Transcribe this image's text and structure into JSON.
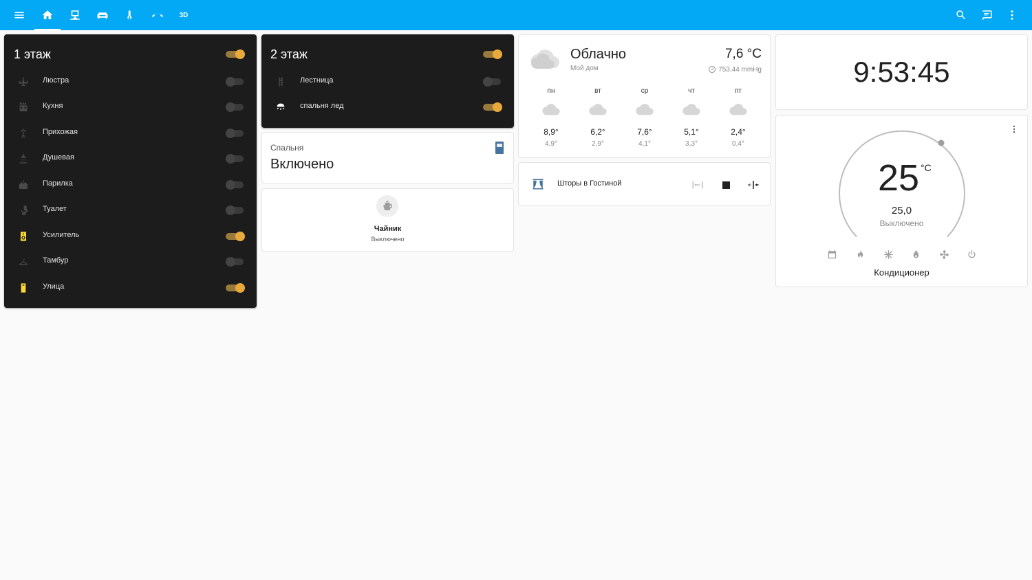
{
  "topbar": {
    "tabs": [
      {
        "icon": "home-icon",
        "active": true
      },
      {
        "icon": "desk-icon"
      },
      {
        "icon": "sofa-icon"
      },
      {
        "icon": "thermometer-icon"
      },
      {
        "icon": "phone-hangup-icon"
      },
      {
        "label": "3D"
      }
    ]
  },
  "floor1": {
    "title": "1 этаж",
    "master_on": true,
    "items": [
      {
        "name": "Люстра",
        "icon": "chandelier-icon",
        "on": false
      },
      {
        "name": "Кухня",
        "icon": "stove-icon",
        "on": false
      },
      {
        "name": "Прихожая",
        "icon": "lamp-icon",
        "on": false
      },
      {
        "name": "Душевая",
        "icon": "shower-icon",
        "on": false
      },
      {
        "name": "Парилка",
        "icon": "sauna-icon",
        "on": false
      },
      {
        "name": "Туалет",
        "icon": "toilet-icon",
        "on": false
      },
      {
        "name": "Усилитель",
        "icon": "speaker-icon",
        "on": true
      },
      {
        "name": "Тамбур",
        "icon": "hanger-icon",
        "on": false
      },
      {
        "name": "Улица",
        "icon": "outdoor-lamp-icon",
        "on": true
      }
    ]
  },
  "floor2": {
    "title": "2 этаж",
    "master_on": true,
    "items": [
      {
        "name": "Лестница",
        "icon": "stairs-icon",
        "on": false
      },
      {
        "name": "спальня лед",
        "icon": "ceiling-light-icon",
        "on": true
      }
    ]
  },
  "bedroom": {
    "label": "Спальня",
    "state": "Включено",
    "icon": "door-icon"
  },
  "kettle": {
    "name": "Чайник",
    "state": "Выключено",
    "icon": "kettle-icon"
  },
  "weather": {
    "condition": "Облачно",
    "location": "Мой дом",
    "temperature": "7,6 °C",
    "pressure": "753,44 mmHg",
    "forecast": [
      {
        "day": "пн",
        "hi": "8,9°",
        "lo": "4,9°"
      },
      {
        "day": "вт",
        "hi": "6,2°",
        "lo": "2,9°"
      },
      {
        "day": "ср",
        "hi": "7,6°",
        "lo": "4,1°"
      },
      {
        "day": "чт",
        "hi": "5,1°",
        "lo": "3,3°"
      },
      {
        "day": "пт",
        "hi": "2,4°",
        "lo": "0,4°"
      }
    ]
  },
  "curtains": {
    "name": "Шторы в Гостиной",
    "icon": "curtains-icon"
  },
  "clock": {
    "time": "9:53:45"
  },
  "thermostat": {
    "current": "25",
    "unit": "°C",
    "target": "25,0",
    "state": "Выключено",
    "name": "Кондиционер",
    "modes": [
      "calendar-icon",
      "flame-icon",
      "snowflake-icon",
      "water-icon",
      "fan-icon",
      "power-icon"
    ]
  },
  "colors": {
    "header": "#03a9f4",
    "accent": "#e8a93c",
    "dark_card": "#1c1c1c",
    "icon_active": "#fdd835",
    "icon_inactive": "#4a4a4a",
    "door_icon": "#44739e"
  }
}
